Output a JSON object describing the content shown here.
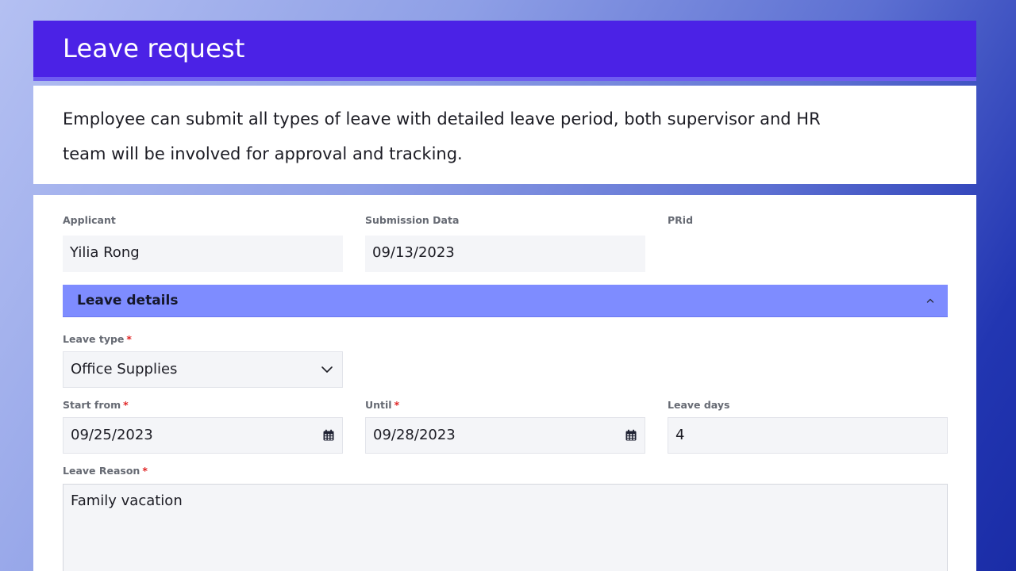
{
  "header": {
    "title": "Leave request"
  },
  "description": {
    "text": "Employee can submit all types of leave with detailed leave period, both supervisor and HR team will be involved for approval and tracking."
  },
  "form": {
    "applicant": {
      "label": "Applicant",
      "value": "Yilia Rong"
    },
    "submission": {
      "label": "Submission Data",
      "value": "09/13/2023"
    },
    "prid": {
      "label": "PRid",
      "value": ""
    },
    "section": {
      "title": "Leave details",
      "chevron_icon": "chevron-up-icon"
    },
    "leave_type": {
      "label": "Leave type",
      "required_mark": "*",
      "value": "Office Supplies",
      "icon": "chevron-down-icon"
    },
    "start_from": {
      "label": "Start from",
      "required_mark": "*",
      "value": "09/25/2023",
      "icon": "calendar-icon"
    },
    "until": {
      "label": "Until",
      "required_mark": "*",
      "value": "09/28/2023",
      "icon": "calendar-icon"
    },
    "leave_days": {
      "label": "Leave days",
      "value": "4"
    },
    "leave_reason": {
      "label": "Leave Reason",
      "required_mark": "*",
      "value": "Family vacation"
    }
  },
  "colors": {
    "header_bg": "#4b22e6",
    "section_bg": "#7e8cff",
    "field_bg": "#f4f5f8",
    "required": "#e02424"
  }
}
